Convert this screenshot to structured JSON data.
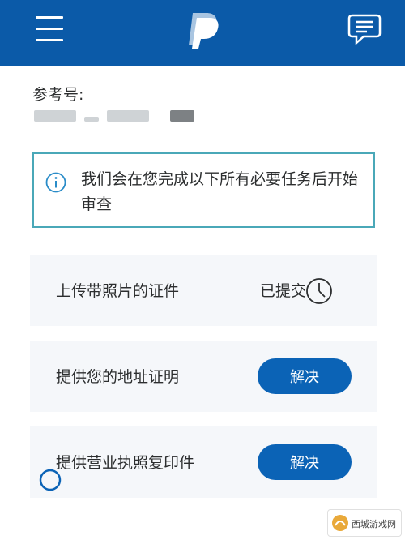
{
  "header": {
    "menu_icon": "hamburger-menu-icon",
    "logo": "paypal-logo",
    "chat_icon": "chat-message-icon",
    "background_color": "#0b5aa8"
  },
  "reference": {
    "label": "参考号:",
    "value_redacted": true
  },
  "notice": {
    "icon": "info-circle-icon",
    "text": "我们会在您完成以下所有必要任务后开始审查",
    "border_color": "#4aa8b8"
  },
  "tasks": [
    {
      "label": "上传带照片的证件",
      "status": "已提交",
      "status_icon": "clock-icon"
    },
    {
      "label": "提供您的地址证明",
      "action": "解决"
    },
    {
      "label": "提供营业执照复印件",
      "action": "解决"
    }
  ],
  "button_color": "#0b63b6",
  "watermark": {
    "text": "西城游戏网"
  }
}
